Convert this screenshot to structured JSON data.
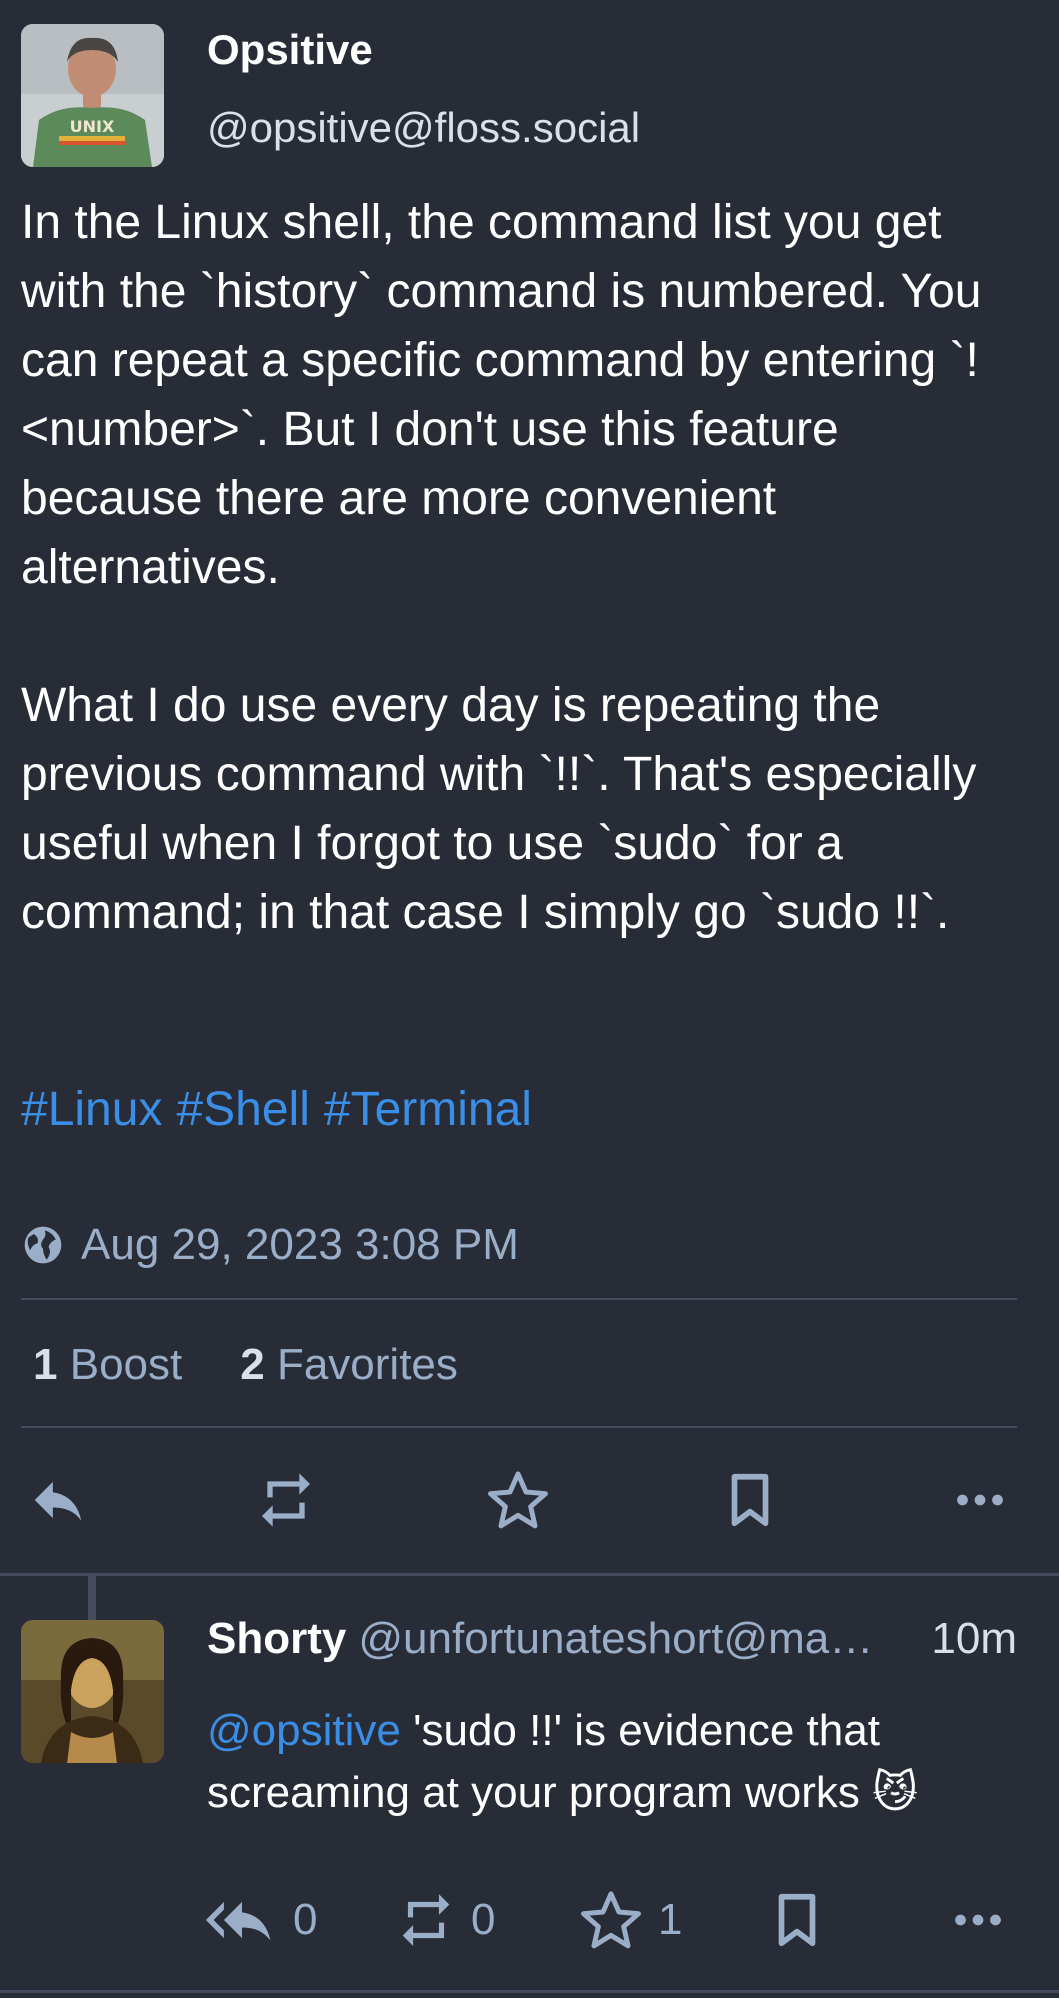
{
  "post": {
    "display_name": "Opsitive",
    "handle": "@opsitive@floss.social",
    "avatar_shirt_text": "UNIX",
    "paragraphs": [
      "In the Linux shell, the command list you get with the `history` command is numbered. You can repeat a specific command by entering `!<number>`. But I don't use this feature because there are more convenient alternatives.",
      "What I do use every day is repeating the previous command with `!!`. That's especially useful when I forgot to use `sudo` for a command; in that case I simply go `sudo !!`."
    ],
    "hashtags": [
      "#Linux",
      "#Shell",
      "#Terminal"
    ],
    "timestamp": "Aug 29, 2023 3:08 PM",
    "visibility_icon": "globe-icon",
    "boost_count": "1",
    "boost_label": "Boost",
    "favorite_count": "2",
    "favorite_label": "Favorites",
    "actions": [
      "reply-icon",
      "boost-icon",
      "star-icon",
      "bookmark-icon",
      "more-icon"
    ]
  },
  "reply": {
    "display_name": "Shorty",
    "handle": "@unfortunateshort@ma…",
    "time": "10m",
    "mention": "@opsitive",
    "text": " 'sudo !!' is evidence that screaming at your program works ",
    "emoji": "😼",
    "reply_count": "0",
    "boost_count": "0",
    "favorite_count": "1"
  },
  "colors": {
    "background": "#282c37",
    "link": "#3a8ee6",
    "secondary_text": "#9baec8",
    "divider": "#444b5d"
  }
}
